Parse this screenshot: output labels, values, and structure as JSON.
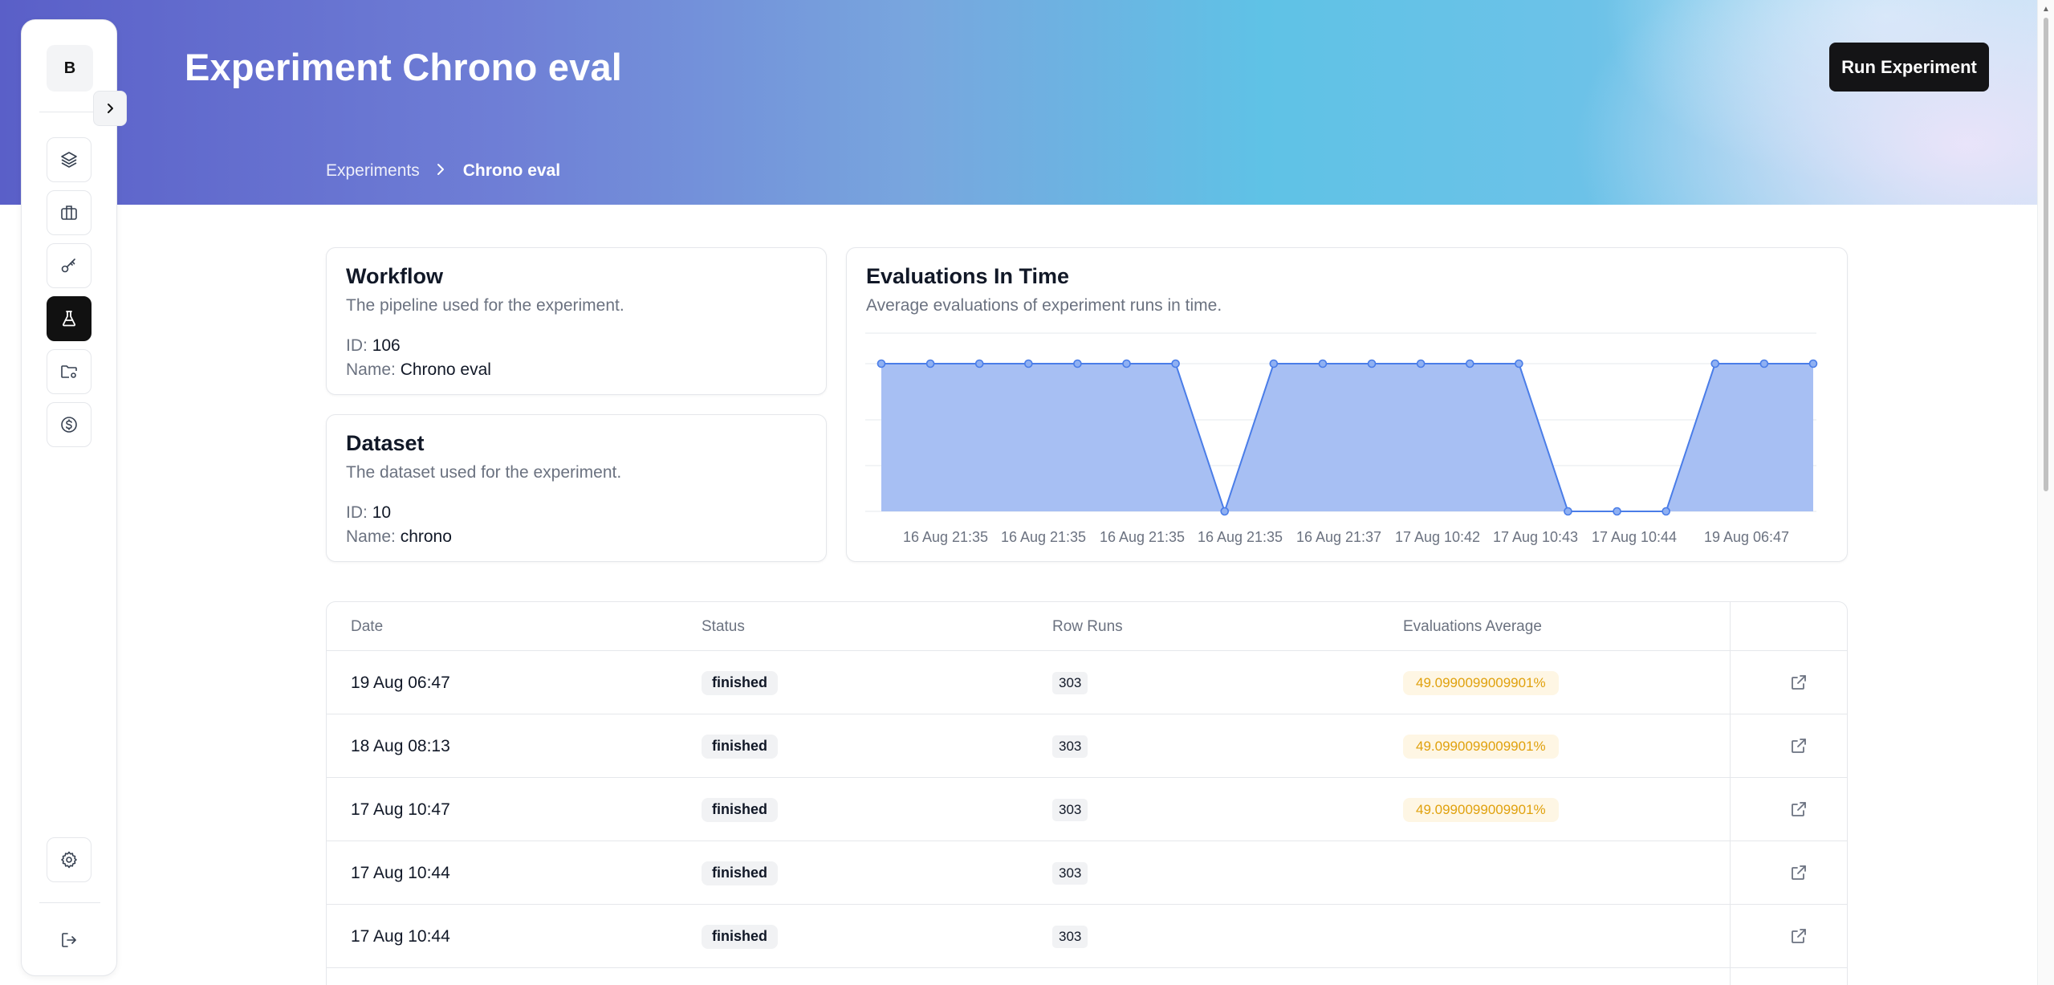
{
  "header": {
    "title": "Experiment Chrono eval",
    "run_button": "Run Experiment",
    "breadcrumb": {
      "parent": "Experiments",
      "current": "Chrono eval"
    }
  },
  "sidebar": {
    "avatar_letter": "B",
    "items": [
      {
        "icon": "layers-icon",
        "active": false
      },
      {
        "icon": "briefcase-icon",
        "active": false
      },
      {
        "icon": "key-icon",
        "active": false
      },
      {
        "icon": "flask-icon",
        "active": true
      },
      {
        "icon": "folder-settings-icon",
        "active": false
      },
      {
        "icon": "dollar-circle-icon",
        "active": false
      }
    ],
    "bottom": [
      "gear-icon",
      "logout-icon"
    ]
  },
  "workflow": {
    "title": "Workflow",
    "description": "The pipeline used for the experiment.",
    "id_label": "ID:",
    "id": "106",
    "name_label": "Name:",
    "name": "Chrono eval"
  },
  "dataset": {
    "title": "Dataset",
    "description": "The dataset used for the experiment.",
    "id_label": "ID:",
    "id": "10",
    "name_label": "Name:",
    "name": "chrono"
  },
  "evaluations": {
    "title": "Evaluations In Time",
    "description": "Average evaluations of experiment runs in time."
  },
  "chart_data": {
    "type": "area",
    "ylim": [
      0,
      49.0990099009901
    ],
    "grid": true,
    "color": "#4a7de8",
    "fill": "#a7bff3",
    "x_ticks": [
      "16 Aug 21:35",
      "16 Aug 21:35",
      "16 Aug 21:35",
      "16 Aug 21:35",
      "16 Aug 21:37",
      "17 Aug 10:42",
      "17 Aug 10:43",
      "17 Aug 10:44",
      "19 Aug 06:47"
    ],
    "values": [
      49.0990099009901,
      49.0990099009901,
      49.0990099009901,
      49.0990099009901,
      49.0990099009901,
      49.0990099009901,
      49.0990099009901,
      0,
      49.0990099009901,
      49.0990099009901,
      49.0990099009901,
      49.0990099009901,
      49.0990099009901,
      49.0990099009901,
      0,
      0,
      0,
      49.0990099009901,
      49.0990099009901,
      49.0990099009901
    ]
  },
  "table": {
    "columns": [
      "Date",
      "Status",
      "Row Runs",
      "Evaluations Average"
    ],
    "rows": [
      {
        "date": "19 Aug 06:47",
        "status": "finished",
        "row_runs": "303",
        "avg": "49.0990099009901%"
      },
      {
        "date": "18 Aug 08:13",
        "status": "finished",
        "row_runs": "303",
        "avg": "49.0990099009901%"
      },
      {
        "date": "17 Aug 10:47",
        "status": "finished",
        "row_runs": "303",
        "avg": "49.0990099009901%"
      },
      {
        "date": "17 Aug 10:44",
        "status": "finished",
        "row_runs": "303",
        "avg": ""
      },
      {
        "date": "17 Aug 10:44",
        "status": "finished",
        "row_runs": "303",
        "avg": ""
      }
    ]
  }
}
